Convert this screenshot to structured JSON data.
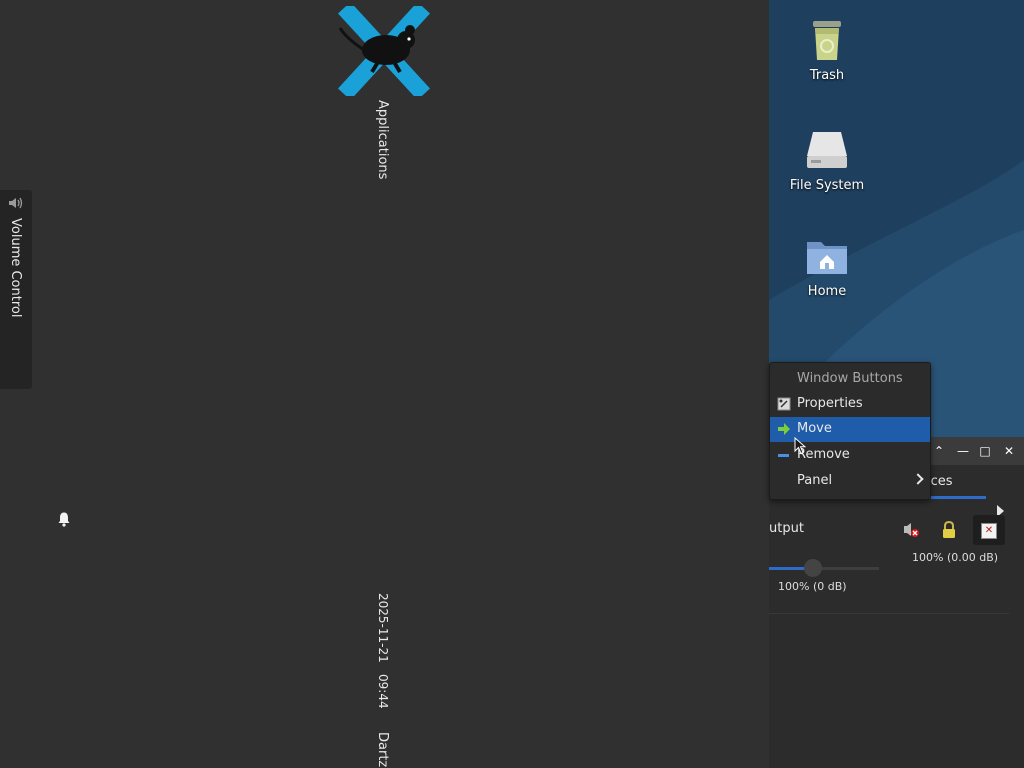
{
  "panel": {
    "volume_label": "Volume Control",
    "applications_label": "Applications",
    "date": "2025-11-21",
    "time": "09:44",
    "user": "Dartz"
  },
  "desktop": {
    "icons": [
      {
        "label": "Trash",
        "icon": "trash-icon"
      },
      {
        "label": "File System",
        "icon": "drive-icon"
      },
      {
        "label": "Home",
        "icon": "home-folder-icon"
      }
    ]
  },
  "pavucontrol": {
    "tab_label": "ices",
    "output_label": "utput",
    "volume_percent_db": "100% (0.00 dB)",
    "slider_label": "100% (0 dB)",
    "slider_value": 1.0
  },
  "context_menu": {
    "header": "Window Buttons",
    "items": [
      {
        "label": "Properties",
        "icon": "properties-icon"
      },
      {
        "label": "Move",
        "icon": "move-arrow-icon"
      },
      {
        "label": "Remove",
        "icon": "remove-icon"
      },
      {
        "label": "Panel",
        "icon": "chevron-right-icon"
      }
    ]
  },
  "colors": {
    "menu_highlight": "#1f5daa",
    "accent_blue": "#2f6cc9",
    "desktop_bg": "#234a6b"
  }
}
